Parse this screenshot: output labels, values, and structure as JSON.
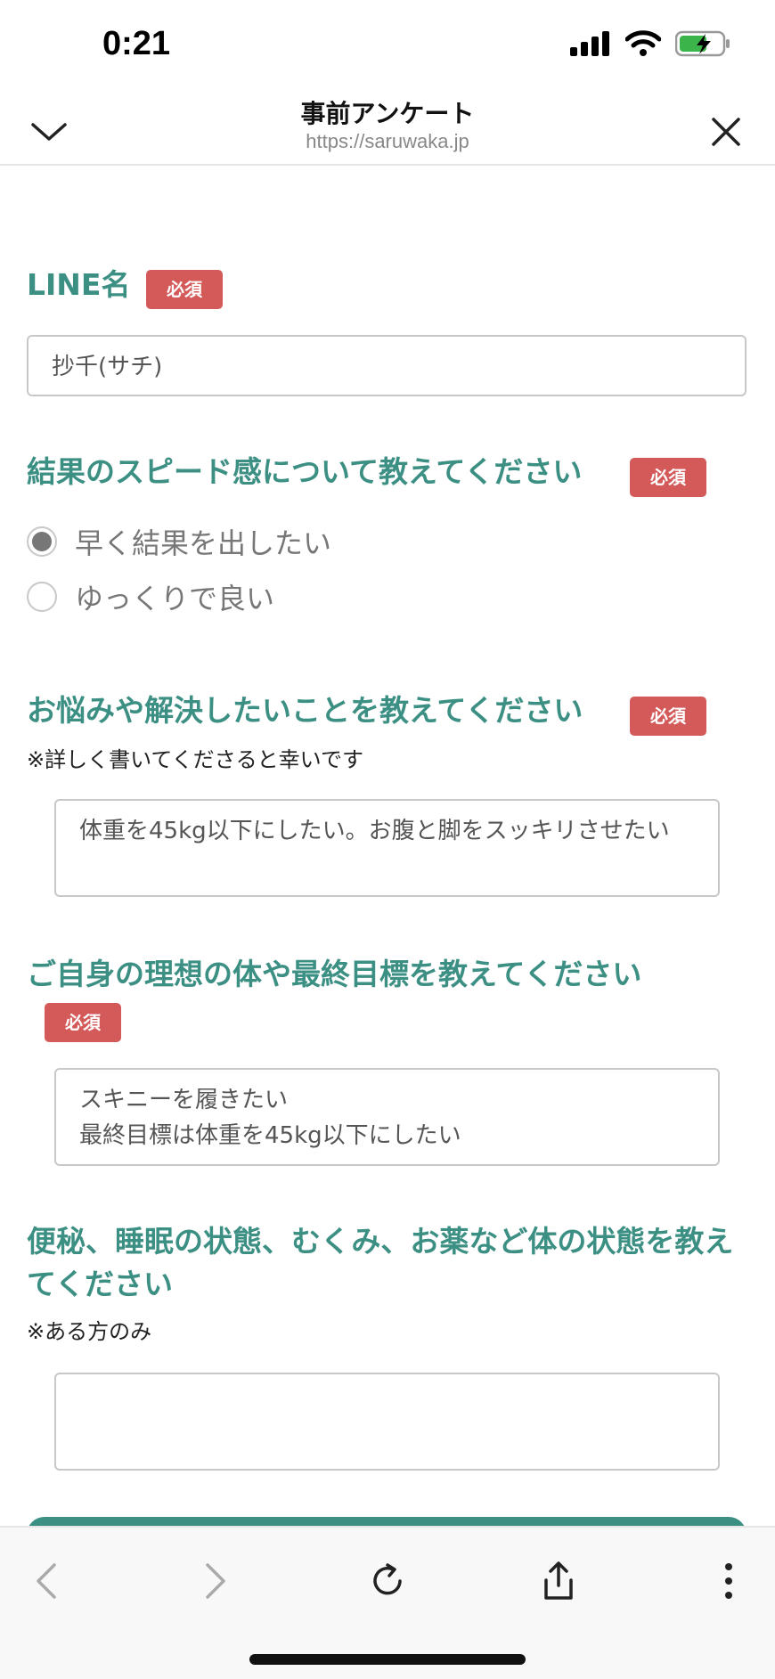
{
  "status": {
    "time": "0:21"
  },
  "header": {
    "title": "事前アンケート",
    "url": "https://saruwaka.jp"
  },
  "form": {
    "required_label": "必須",
    "line_name": {
      "label": "LINE名",
      "value": "抄千(サチ)"
    },
    "speed": {
      "label": "結果のスピード感について教えてください",
      "options": [
        "早く結果を出したい",
        "ゆっくりで良い"
      ],
      "selected": "早く結果を出したい"
    },
    "worries": {
      "label": "お悩みや解決したいことを教えてください",
      "note": "※詳しく書いてくださると幸いです",
      "value": "体重を45kg以下にしたい。お腹と脚をスッキリさせたい"
    },
    "goal": {
      "label": "ご自身の理想の体や最終目標を教えてください",
      "value": "スキニーを履きたい\n最終目標は体重を45kg以下にしたい"
    },
    "condition": {
      "label": "便秘、睡眠の状態、むくみ、お薬など体の状態を教えてください",
      "note": "※ある方のみ",
      "value": ""
    }
  },
  "colors": {
    "accent": "#3c8f83",
    "required": "#d45a5a"
  },
  "icons": [
    "signal-icon",
    "wifi-icon",
    "battery-icon",
    "chevron-down-icon",
    "close-icon",
    "back-icon",
    "forward-icon",
    "reload-icon",
    "share-icon",
    "more-icon"
  ]
}
